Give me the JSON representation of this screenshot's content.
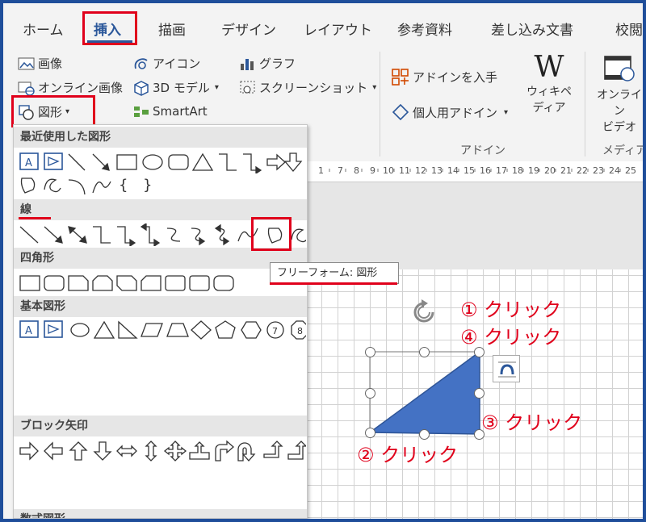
{
  "tabs": [
    "ホーム",
    "挿入",
    "描画",
    "デザイン",
    "レイアウト",
    "参考資料",
    "差し込み文書",
    "校閲"
  ],
  "ribbon": {
    "picture": "画像",
    "online_picture": "オンライン画像",
    "shapes": "図形",
    "icons": "アイコン",
    "model3d": "3D モデル",
    "smartart": "SmartArt",
    "chart": "グラフ",
    "screenshot": "スクリーンショット",
    "get_addins": "アドインを入手",
    "my_addins": "個人用アドイン",
    "wiki_line1": "ウィキペ",
    "wiki_line2": "ディア",
    "online_video_line1": "オンライン",
    "online_video_line2": "ビデオ",
    "group_addins": "アドイン",
    "group_media": "メディア"
  },
  "shapes_panel": {
    "recent": "最近使用した図形",
    "lines": "線",
    "rectangles": "四角形",
    "basic": "基本図形",
    "block_arrows": "ブロック矢印",
    "equation": "数式図形"
  },
  "tooltip": "フリーフォーム: 図形",
  "annotations": {
    "a1": "① クリック",
    "a4": "④ クリック",
    "a3": "③ クリック",
    "a2": "② クリック"
  },
  "colors": {
    "accent": "#2b579a",
    "highlight": "#e0001b",
    "shape_fill": "#4472c4"
  }
}
